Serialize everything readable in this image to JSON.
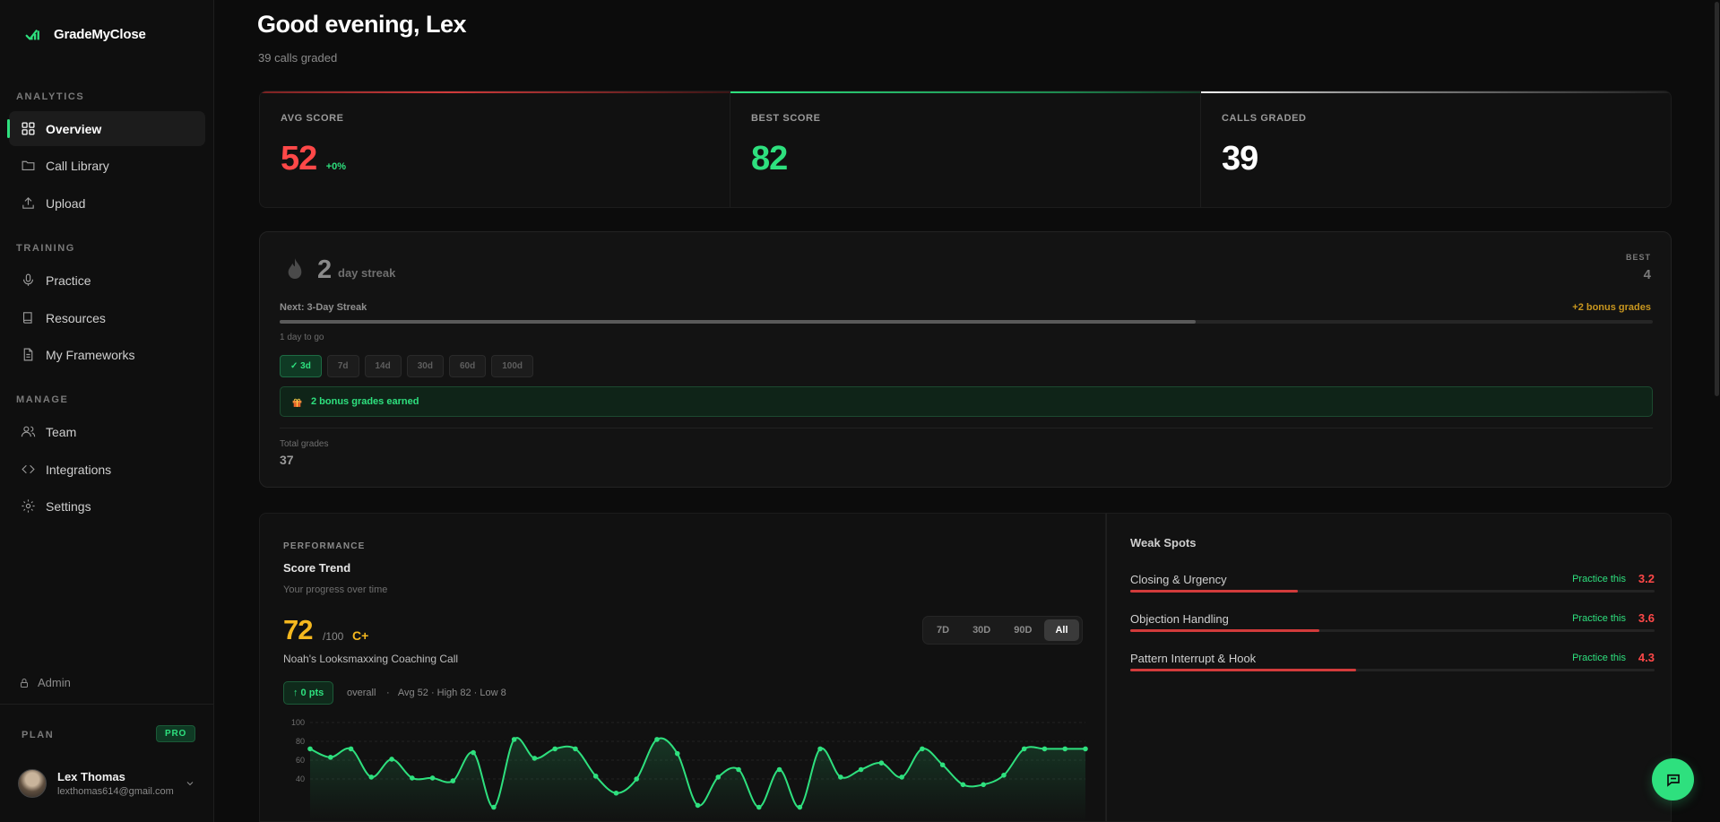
{
  "brand": {
    "name": "GradeMyClose"
  },
  "sidebar": {
    "sections": [
      {
        "label": "ANALYTICS"
      },
      {
        "label": "TRAINING"
      },
      {
        "label": "MANAGE"
      }
    ],
    "items": [
      {
        "label": "Overview",
        "icon": "grid-icon",
        "active": true
      },
      {
        "label": "Call Library",
        "icon": "folder-icon"
      },
      {
        "label": "Upload",
        "icon": "upload-icon"
      },
      {
        "label": "Practice",
        "icon": "microphone-icon"
      },
      {
        "label": "Resources",
        "icon": "book-icon"
      },
      {
        "label": "My Frameworks",
        "icon": "document-icon"
      },
      {
        "label": "Team",
        "icon": "users-icon"
      },
      {
        "label": "Integrations",
        "icon": "code-icon"
      },
      {
        "label": "Settings",
        "icon": "gear-icon"
      }
    ],
    "admin": "Admin",
    "plan_label": "PLAN",
    "plan_badge": "PRO",
    "user": {
      "name": "Lex Thomas",
      "email": "lexthomas614@gmail.com"
    }
  },
  "header": {
    "greeting": "Good evening, Lex",
    "subtitle": "39 calls graded"
  },
  "stats": [
    {
      "label": "AVG SCORE",
      "value": "52",
      "delta": "+0%",
      "color": "#ff4848",
      "bar_color": "#d23b3b"
    },
    {
      "label": "BEST SCORE",
      "value": "82",
      "delta": "",
      "color": "#2ee07e",
      "bar_color": "#2ee07e"
    },
    {
      "label": "CALLS GRADED",
      "value": "39",
      "delta": "",
      "color": "#ffffff",
      "bar_color": "#d9d9d9"
    }
  ],
  "streak": {
    "count": "2",
    "label": "day streak",
    "best_label": "BEST",
    "best_value": "4",
    "next_label": "Next: 3-Day Streak",
    "bonus_label": "+2 bonus grades",
    "progress": 0.667,
    "to_go": "1 day to go",
    "milestones": [
      {
        "label": "✓ 3d",
        "done": true
      },
      {
        "label": "7d",
        "done": false
      },
      {
        "label": "14d",
        "done": false
      },
      {
        "label": "30d",
        "done": false
      },
      {
        "label": "60d",
        "done": false
      },
      {
        "label": "100d",
        "done": false
      }
    ],
    "bonus_earned": "2 bonus grades earned",
    "total_label": "Total grades",
    "total_value": "37"
  },
  "performance": {
    "kicker": "PERFORMANCE",
    "title": "Score Trend",
    "subtitle": "Your progress over time",
    "score": "72",
    "score_out_of": "/100",
    "grade": "C+",
    "call_name": "Noah's Looksmaxxing Coaching Call",
    "ranges": [
      "7D",
      "30D",
      "90D",
      "All"
    ],
    "active_range": "All",
    "pts_badge": "↑ 0 pts",
    "overall": "overall",
    "summary": "Avg 52 · High 82 · Low 8"
  },
  "chart_data": {
    "type": "area",
    "y_ticks": [
      "100",
      "80",
      "60",
      "40"
    ],
    "ylim": [
      0,
      100
    ],
    "values": [
      72,
      63,
      72,
      42,
      61,
      41,
      41,
      38,
      68,
      10,
      82,
      62,
      72,
      72,
      43,
      25,
      40,
      82,
      67,
      12,
      42,
      50,
      10,
      50,
      10,
      72,
      42,
      50,
      57,
      42,
      72,
      55,
      34,
      34,
      44,
      72,
      72,
      72,
      72
    ],
    "line_color": "#2ee07e"
  },
  "weak_spots": {
    "title": "Weak Spots",
    "practice_label": "Practice this",
    "items": [
      {
        "name": "Closing & Urgency",
        "score": "3.2",
        "fill": 0.32
      },
      {
        "name": "Objection Handling",
        "score": "3.6",
        "fill": 0.36
      },
      {
        "name": "Pattern Interrupt & Hook",
        "score": "4.3",
        "fill": 0.43
      }
    ]
  }
}
